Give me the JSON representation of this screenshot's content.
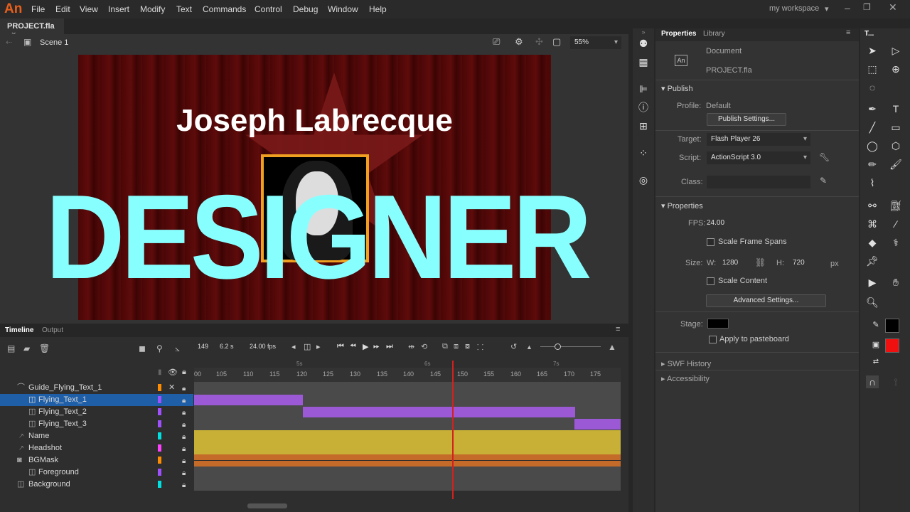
{
  "app": {
    "logo": "An",
    "workspace": "my workspace"
  },
  "menu": [
    "File",
    "Edit",
    "View",
    "Insert",
    "Modify",
    "Text",
    "Commands",
    "Control",
    "Debug",
    "Window",
    "Help"
  ],
  "document": {
    "tab": "PROJECT.fla",
    "scene": "Scene 1",
    "zoom": "55%"
  },
  "stage": {
    "title": "Joseph Labrecque",
    "headline": "DESIGNER"
  },
  "properties": {
    "tabs": [
      "Properties",
      "Library"
    ],
    "doc_label": "Document",
    "doc_name": "PROJECT.fla",
    "publish_header": "Publish",
    "profile_label": "Profile:",
    "profile_value": "Default",
    "publish_settings": "Publish Settings...",
    "target_label": "Target:",
    "target_value": "Flash Player 26",
    "script_label": "Script:",
    "script_value": "ActionScript 3.0",
    "class_label": "Class:",
    "props_header": "Properties",
    "fps_label": "FPS:",
    "fps_value": "24.00",
    "scale_frame_spans": "Scale Frame Spans",
    "size_label": "Size:",
    "w_label": "W:",
    "w_value": "1280",
    "h_label": "H:",
    "h_value": "720",
    "px": "px",
    "scale_content": "Scale Content",
    "advanced": "Advanced Settings...",
    "stage_label": "Stage:",
    "stage_color": "#000000",
    "apply_pasteboard": "Apply to pasteboard",
    "swf_history": "SWF History",
    "accessibility": "Accessibility"
  },
  "tools_panel_title": "T...",
  "timeline": {
    "tabs": [
      "Timeline",
      "Output"
    ],
    "frame": "149",
    "time": "6.2 s",
    "fps": "24.00 fps",
    "ticks": [
      "00",
      "105",
      "110",
      "115",
      "120",
      "125",
      "130",
      "135",
      "140",
      "145",
      "150",
      "155",
      "160",
      "165",
      "170",
      "175"
    ],
    "second_marks": [
      "5s",
      "6s",
      "7s"
    ],
    "layers": [
      {
        "name": "Guide_Flying_Text_1",
        "color": "#ff8c00"
      },
      {
        "name": "Flying_Text_1",
        "color": "#a050ff"
      },
      {
        "name": "Flying_Text_2",
        "color": "#a050ff"
      },
      {
        "name": "Flying_Text_3",
        "color": "#a050ff"
      },
      {
        "name": "Name",
        "color": "#00e0e0"
      },
      {
        "name": "Headshot",
        "color": "#ff40ff"
      },
      {
        "name": "BGMask",
        "color": "#ff8c00"
      },
      {
        "name": "Foreground",
        "color": "#a050ff"
      },
      {
        "name": "Background",
        "color": "#00e0e0"
      }
    ]
  }
}
